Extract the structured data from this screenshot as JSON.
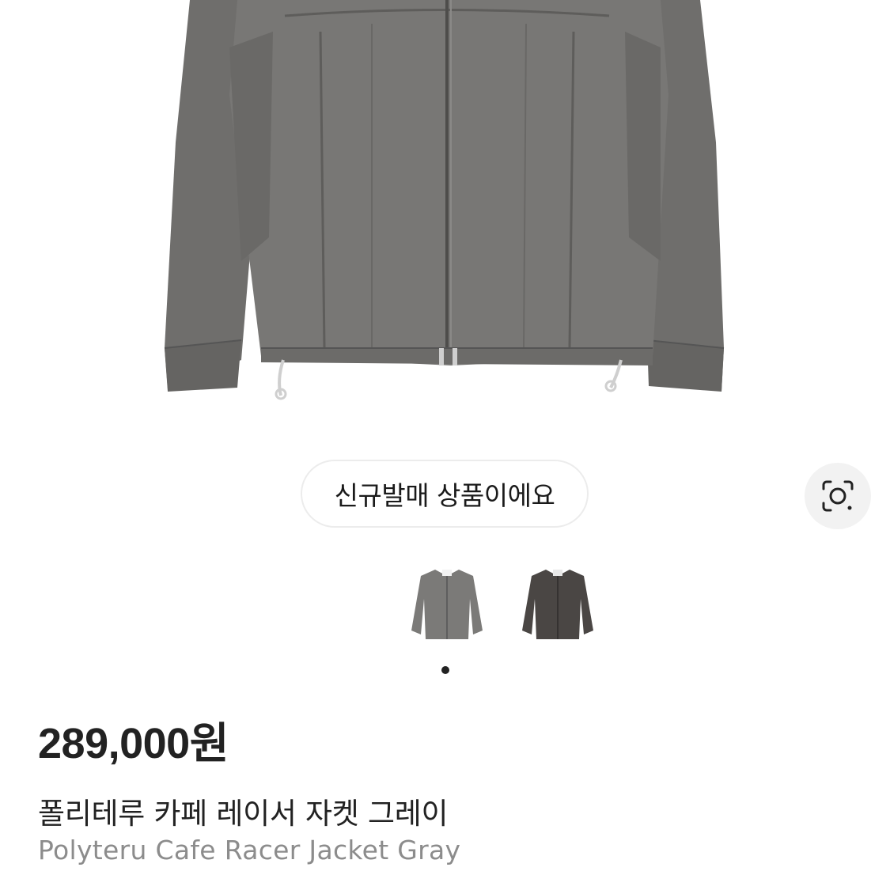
{
  "product": {
    "badge_text": "신규발매 상품이에요",
    "price": "289,000원",
    "name_ko": "폴리테루 카페 레이서 자켓 그레이",
    "name_en": "Polyteru Cafe Racer Jacket Gray"
  },
  "thumbnails": [
    {
      "color": "#7b7a78"
    },
    {
      "color": "#4a4644"
    }
  ],
  "carousel": {
    "active_index": 0
  },
  "icons": {
    "lens_button": "image-search-icon"
  },
  "colors": {
    "jacket_main": "#767573",
    "jacket_shadow": "#5f5e5c",
    "badge_border": "#ececec",
    "lens_bg": "#f2f2f2"
  }
}
